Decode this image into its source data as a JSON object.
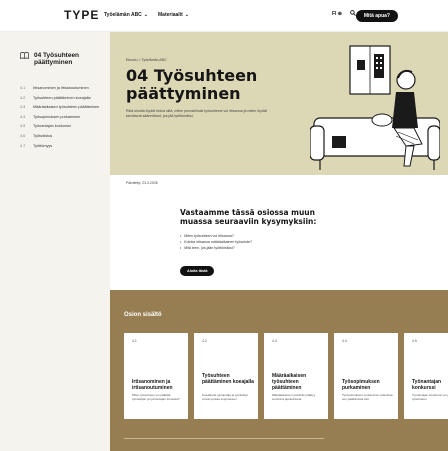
{
  "header": {
    "logo": "TYPE",
    "nav": [
      {
        "label": "Työelämän ABC"
      },
      {
        "label": "Materiaalit"
      }
    ],
    "lang": "FI",
    "cta_label": "Mitä apua?"
  },
  "sidebar": {
    "title": "04 Työsuhteen päättyminen",
    "items": [
      {
        "num": "4.1",
        "label": "Irtisanominen ja irtisanoutuminen"
      },
      {
        "num": "4.2",
        "label": "Työsuhteen päättäminen koeajalla"
      },
      {
        "num": "4.3",
        "label": "Määräaikaisen työsuhteen päättäminen"
      },
      {
        "num": "4.4",
        "label": "Työsopimuksen purkaminen"
      },
      {
        "num": "4.5",
        "label": "Työnantajan konkurssi"
      },
      {
        "num": "4.6",
        "label": "Työtodistus"
      },
      {
        "num": "4.7",
        "label": "Työttömyys"
      }
    ]
  },
  "hero": {
    "breadcrumb": "Etusivu  >  Työelämän ABC",
    "title": "04 Työsuhteen päättyminen",
    "description": "Riitä sinulta löydät tietoa siitä, miten perustellusti työsuhteesi voi irtisanoa ja miten löydät tarvittavat säännökset, jos jää työttömäksi."
  },
  "published": "Päivitetty: 23.3.2026",
  "questions": {
    "title": "Vastaamme tässä osiossa muun muassa seuraaviin kysymyksiin:",
    "items": [
      "Miten työsuhteen voi irtisanoa?",
      "Kuinka irtisanoa määräaikainen työsuhde?",
      "Mitä teen, jos jään työttömäksi?"
    ],
    "button_label": "Aloita tästä"
  },
  "contents": {
    "title": "Osion sisältö",
    "cards": [
      {
        "num": "4.1",
        "title": "Irtisanominen ja irtisanoutuminen",
        "desc": "Miten työsuhteen voi päättää työntekijän ja työnantajan toimesta?"
      },
      {
        "num": "4.2",
        "title": "Työsuhteen päättäminen koeajalla",
        "desc": "Koeaikana työnantaja ja työntekijä voivat purkaa sopimuksen."
      },
      {
        "num": "4.3",
        "title": "Määräaikaisen työsuhteen päättäminen",
        "desc": "Määräaikainen työsuhde päättyy sovittuna ajankohtana."
      },
      {
        "num": "4.4",
        "title": "Työsopimuksen purkaminen",
        "desc": "Työsopimuksen purkaminen tarkoittaa sen päättämistä heti."
      },
      {
        "num": "4.5",
        "title": "Työnantajan konkurssi",
        "desc": "Työnantajan konkurssi voi päättää työsuhteen."
      }
    ]
  }
}
